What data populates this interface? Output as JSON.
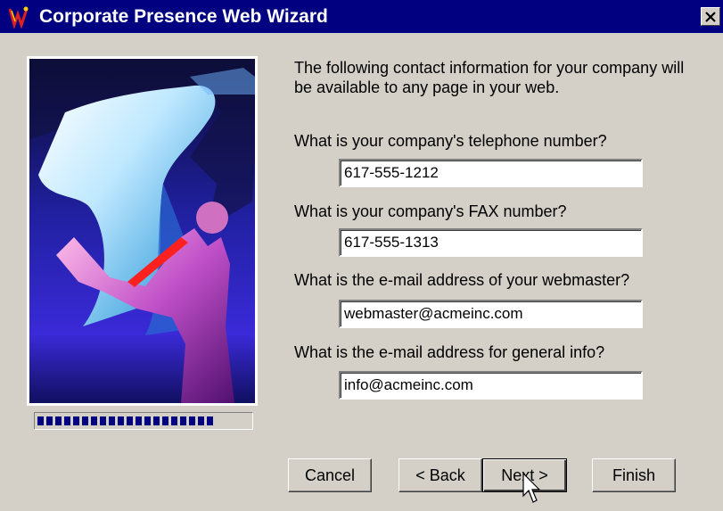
{
  "window": {
    "title": "Corporate Presence Web Wizard",
    "close_label": "×",
    "title_bar_color": "#000080"
  },
  "intro_text": "The following contact information for your company will be available to any page in your web.",
  "fields": {
    "phone": {
      "label": "What is your company's telephone number?",
      "value": "617-555-1212"
    },
    "fax": {
      "label": "What is your company's FAX number?",
      "value": "617-555-1313"
    },
    "webmaster": {
      "label": "What is the e-mail address of your webmaster?",
      "value": "webmaster@acmeinc.com"
    },
    "info": {
      "label": "What is the e-mail address for general info?",
      "value": "info@acmeinc.com"
    }
  },
  "progress": {
    "fraction": 0.87,
    "color": "#000080"
  },
  "buttons": {
    "cancel": "Cancel",
    "back": "< Back",
    "next": "Next >",
    "finish": "Finish"
  },
  "icons": {
    "app": "wizard-app-icon",
    "close": "close-icon",
    "cursor": "mouse-pointer-icon"
  }
}
